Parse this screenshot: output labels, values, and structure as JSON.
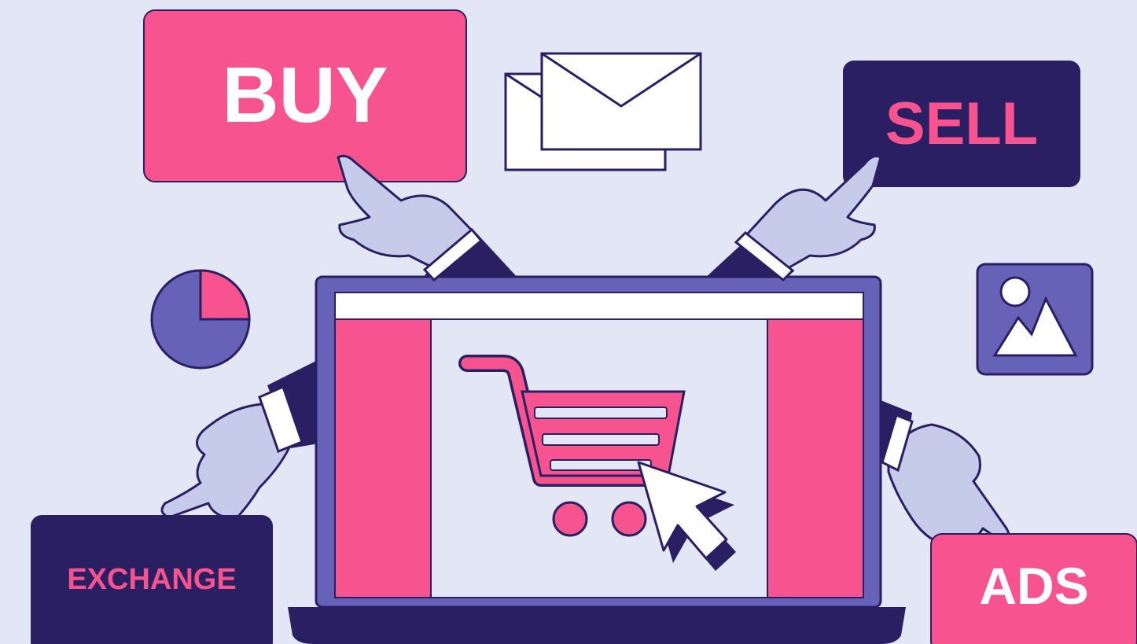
{
  "labels": {
    "buy": "BUY",
    "sell": "SELL",
    "exchange": "EXCHANGE",
    "ads": "ADS"
  },
  "colors": {
    "background": "#e3e6f4",
    "pink": "#f7548f",
    "navy": "#2a1f63",
    "purple": "#6662b8",
    "hand": "#c5cbe9",
    "screen": "#e3e6f4",
    "white": "#ffffff"
  },
  "icons": [
    "envelope-icon",
    "pie-chart-icon",
    "image-icon",
    "shopping-cart-icon",
    "mouse-cursor-icon"
  ],
  "pie_chart": {
    "highlighted_fraction": 0.25
  }
}
